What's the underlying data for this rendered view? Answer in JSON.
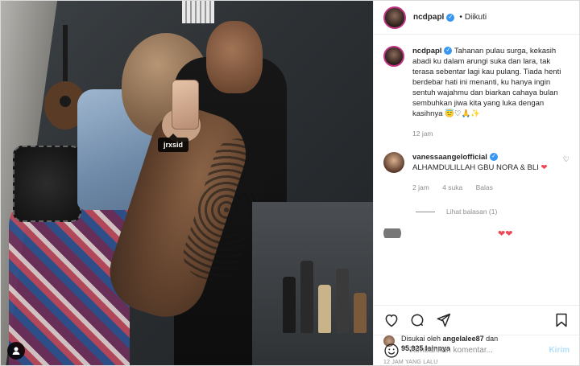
{
  "photo": {
    "tag_label": "jrxsid"
  },
  "header": {
    "username": "ncdpapl",
    "separator": "•",
    "follow_status": "Diikuti"
  },
  "caption": {
    "username": "ncdpapl",
    "text": "Tahanan pulau surga, kekasih abadi ku dalam arungi suka dan lara, tak terasa sebentar lagi kau pulang. Tiada henti berdebar hati ini menanti, ku hanya ingin sentuh wajahmu dan biarkan cahaya bulan sembuhkan jiwa kita yang luka dengan kasihnya",
    "emojis": "😇♡🙏✨",
    "time": "12 jam"
  },
  "comment": {
    "username": "vanessaangelofficial",
    "text": "ALHAMDULILLAH GBU NORA & BLI",
    "emoji": "❤",
    "time": "2 jam",
    "likes": "4 suka",
    "reply": "Balas",
    "view_replies": "Lihat balasan (1)"
  },
  "likes": {
    "liked_by_prefix": "Disukai oleh",
    "liked_by_user": "angelalee87",
    "and": "dan",
    "count": "95,925",
    "others": "lainnya"
  },
  "date": "12 JAM YANG LALU",
  "add_comment": {
    "placeholder": "Tambahkan komentar...",
    "post_label": "Kirim"
  },
  "icons": {
    "heart": "heart-icon",
    "comment": "comment-icon",
    "share": "share-icon",
    "save": "bookmark-icon",
    "emoji": "emoji-icon",
    "user": "user-tag-icon"
  }
}
